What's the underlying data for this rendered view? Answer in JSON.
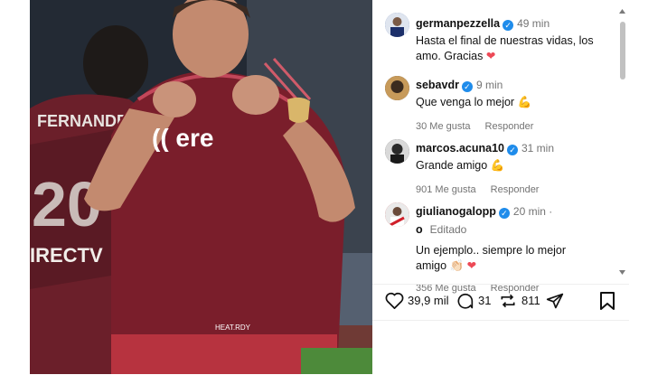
{
  "post": {
    "author": "germanpezzella",
    "time": "49 min",
    "caption_line1": "Hasta el final de nuestras vidas, los",
    "caption_line2": "amo. Gracias",
    "caption_emoji": "❤"
  },
  "comments": [
    {
      "user": "sebavdr",
      "time": "9 min",
      "text_line1": "Que venga lo mejor",
      "text_line2": "",
      "emoji": "💪",
      "likes": "30 Me gusta",
      "reply": "Responder"
    },
    {
      "user": "marcos.acuna10",
      "time": "31 min",
      "text_line1": "Grande amigo",
      "text_line2": "",
      "emoji": "💪",
      "likes": "901 Me gusta",
      "reply": "Responder"
    },
    {
      "user_line1": "giulianogalopp",
      "user_line2": "o",
      "time": "20 min ·",
      "edited": "Editado",
      "text_line1": "Un ejemplo.. siempre lo mejor",
      "text_line2": "amigo",
      "emoji": "👏🏻 ❤",
      "likes": "356 Me gusta",
      "reply": "Responder"
    }
  ],
  "stats": {
    "likes": "39,9 mil",
    "comments": "31",
    "reposts": "811"
  },
  "colors": {
    "verified": "#1f8ceb",
    "heart": "#ed4956",
    "jersey": "#7a1e2b",
    "muted": "#737373"
  }
}
